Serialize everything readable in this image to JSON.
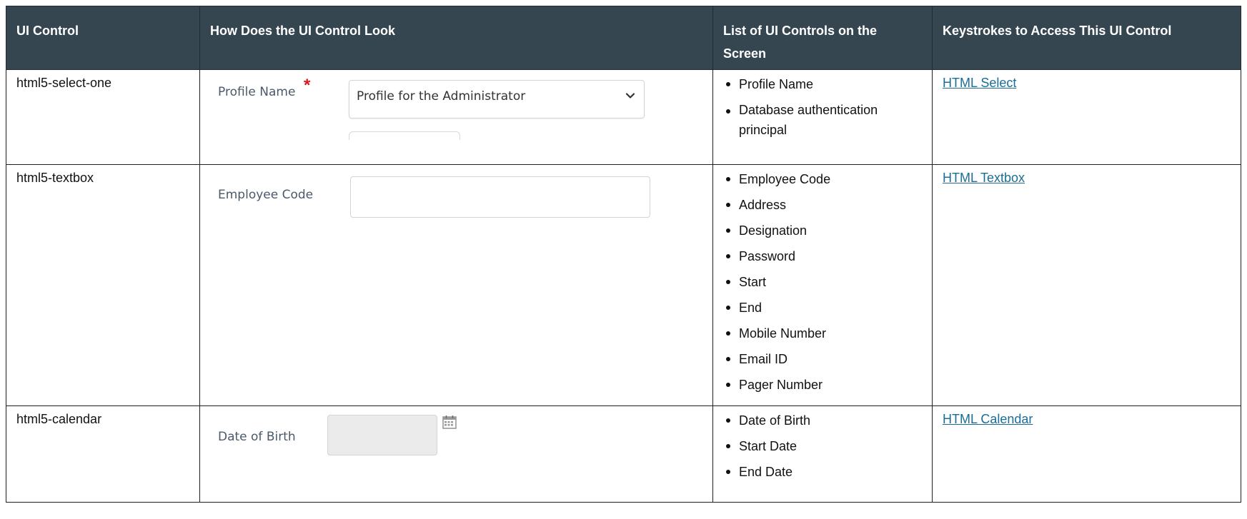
{
  "table": {
    "headers": [
      "UI Control",
      "How Does the UI Control Look",
      "List of UI Controls on the Screen",
      "Keystrokes to Access This UI Control"
    ],
    "rows": [
      {
        "control": "html5-select-one",
        "mock": {
          "label": "Profile Name",
          "required_mark": "*",
          "value": "Profile for the Administrator"
        },
        "controls": [
          "Profile Name",
          "Database authentication principal"
        ],
        "link": "HTML Select"
      },
      {
        "control": "html5-textbox",
        "mock": {
          "label": "Employee Code",
          "value": ""
        },
        "controls": [
          "Employee Code",
          "Address",
          "Designation",
          "Password",
          "Start",
          "End",
          "Mobile Number",
          "Email ID",
          "Pager Number"
        ],
        "link": "HTML Textbox"
      },
      {
        "control": "html5-calendar",
        "mock": {
          "label": "Date of Birth",
          "value": ""
        },
        "controls": [
          "Date of Birth",
          "Start Date",
          "End Date"
        ],
        "link": "HTML Calendar"
      }
    ]
  },
  "colors": {
    "header_bg": "#354651",
    "header_text": "#ffffff",
    "link": "#1a6d96",
    "required": "#e0151d",
    "label": "#4a5a6a"
  },
  "icons": [
    "chevron-down-icon",
    "calendar-icon"
  ]
}
